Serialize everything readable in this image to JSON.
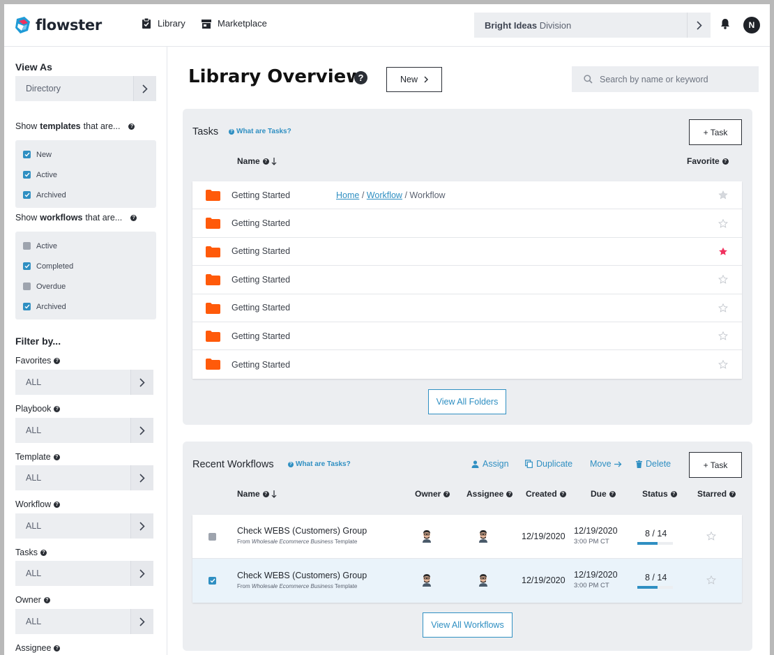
{
  "header": {
    "brand": "flowster",
    "nav": [
      {
        "label": "Library",
        "icon": "clipboard-check-icon"
      },
      {
        "label": "Marketplace",
        "icon": "store-icon"
      }
    ],
    "division_bold": "Bright Ideas",
    "division_rest": " Division",
    "avatar_initial": "N"
  },
  "sidebar": {
    "view_as_title": "View As",
    "view_as_value": "Directory",
    "templates_prefix": "Show",
    "templates_bold": "templates",
    "templates_suffix": "that are...",
    "template_filters": [
      {
        "label": "New",
        "checked": true
      },
      {
        "label": "Active",
        "checked": true
      },
      {
        "label": "Archived",
        "checked": true
      }
    ],
    "workflows_prefix": "Show",
    "workflows_bold": "workflows",
    "workflows_suffix": "that are...",
    "workflow_filters": [
      {
        "label": "Active",
        "checked": false
      },
      {
        "label": "Completed",
        "checked": true
      },
      {
        "label": "Overdue",
        "checked": false
      },
      {
        "label": "Archived",
        "checked": true
      }
    ],
    "filter_title": "Filter by...",
    "filters": [
      {
        "label": "Favorites",
        "value": "ALL"
      },
      {
        "label": "Playbook",
        "value": "ALL"
      },
      {
        "label": "Template",
        "value": "ALL"
      },
      {
        "label": "Workflow",
        "value": "ALL"
      },
      {
        "label": "Tasks",
        "value": "ALL"
      },
      {
        "label": "Owner",
        "value": "ALL"
      },
      {
        "label": "Assignee",
        "value": ""
      }
    ]
  },
  "main": {
    "title": "Library Overview",
    "help": "?",
    "new_label": "New",
    "search_placeholder": "Search by name or keyword",
    "tasks": {
      "title": "Tasks",
      "help_link": "What are Tasks?",
      "add_label": "+ Task",
      "col_name": "Name",
      "col_favorite": "Favorite",
      "breadcrumb": {
        "home": "Home",
        "sep": "/",
        "link": "Workflow",
        "current": "Workflow"
      },
      "rows": [
        {
          "name": "Getting Started",
          "favorite": false
        },
        {
          "name": "Getting Started",
          "favorite": false
        },
        {
          "name": "Getting Started",
          "favorite": true
        },
        {
          "name": "Getting Started",
          "favorite": false
        },
        {
          "name": "Getting Started",
          "favorite": false
        },
        {
          "name": "Getting Started",
          "favorite": false
        },
        {
          "name": "Getting Started",
          "favorite": false
        }
      ],
      "view_all": "View All Folders"
    },
    "workflows": {
      "title": "Recent Workflows",
      "help_link": "What are Tasks?",
      "actions": {
        "assign": "Assign",
        "duplicate": "Duplicate",
        "move": "Move",
        "delete": "Delete"
      },
      "add_label": "+ Task",
      "columns": {
        "name": "Name",
        "owner": "Owner",
        "assignee": "Assignee",
        "created": "Created",
        "due": "Due",
        "status": "Status",
        "starred": "Starred"
      },
      "rows": [
        {
          "name": "Check WEBS (Customers) Group",
          "from_prefix": "From ",
          "template": "Wholesale Ecommerce Business",
          "from_suffix": " Template",
          "created": "12/19/2020",
          "due_date": "12/19/2020",
          "due_time": "3:00 PM CT",
          "status": "8 / 14",
          "progress": 0.571,
          "checked": false
        },
        {
          "name": "Check WEBS (Customers) Group",
          "from_prefix": "From ",
          "template": "Wholesale Ecommerce Business",
          "from_suffix": " Template",
          "created": "12/19/2020",
          "due_date": "12/19/2020",
          "due_time": "3:00 PM CT",
          "status": "8 / 14",
          "progress": 0.571,
          "checked": true
        }
      ],
      "view_all": "View All Workflows"
    }
  },
  "colors": {
    "accent": "#2f8fc2",
    "folder": "#ff5a0a",
    "favorite_star": "#f0315e",
    "panel": "#eceef1"
  }
}
